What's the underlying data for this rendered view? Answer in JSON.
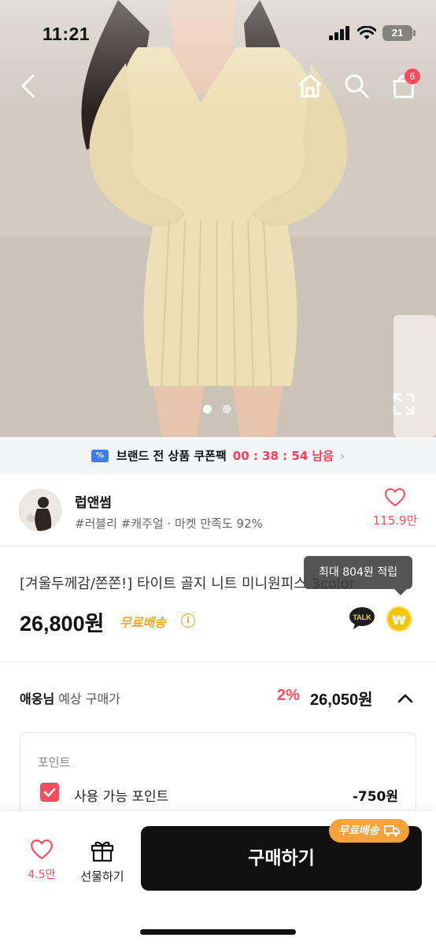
{
  "status_bar": {
    "time": "11:21",
    "battery": "21"
  },
  "nav": {
    "cart_count": "6"
  },
  "carousel": {
    "total": 2,
    "active": 1
  },
  "coupon_banner": {
    "text": "브랜드 전 상품 쿠폰팩",
    "timer": "00 : 38 : 54 남음",
    "chevron": "›"
  },
  "brand": {
    "name": "럽앤썸",
    "meta": "#러블리 #캐주얼 · 마켓 만족도 92%",
    "likes": "115.9만"
  },
  "product": {
    "title": "[겨울두께감/쫀쫀!] 타이트 골지 니트 미니원피스 3color",
    "price": "26,800원",
    "shipping": "무료배송",
    "info_symbol": "i",
    "talk_label": "TALK",
    "won_symbol": "₩",
    "points_tooltip": "최대 804원 적립"
  },
  "expected_price": {
    "user": "애옹님",
    "label": "예상 구매가",
    "discount": "2%",
    "final": "26,050원"
  },
  "points": {
    "section_label": "포인트",
    "row_label": "사용 가능 포인트",
    "value": "-750원",
    "checked": true
  },
  "bottom_bar": {
    "like_count": "4.5만",
    "gift_label": "선물하기",
    "buy_label": "구매하기",
    "shipping_badge": "무료배송"
  },
  "colors": {
    "accent": "#ff4b5c",
    "shipping": "#f8a23a",
    "buy_button": "#111111",
    "coupon_icon": "#3d7bf2"
  }
}
